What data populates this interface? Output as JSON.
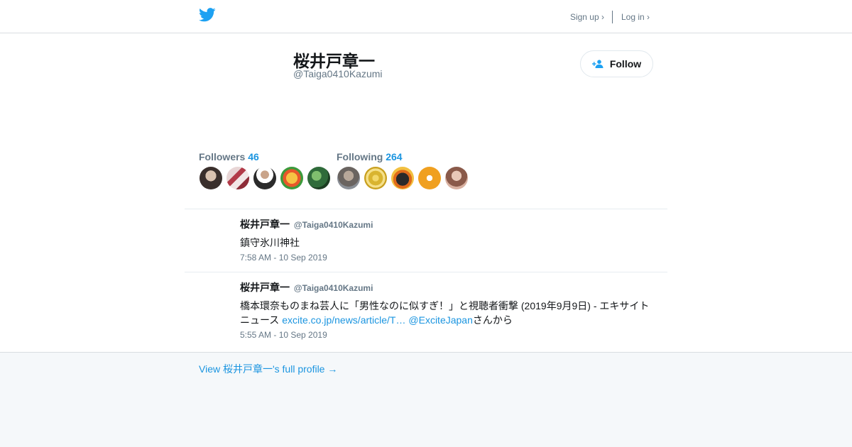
{
  "topbar": {
    "logo_icon": "twitter-bird-icon",
    "sign_up": "Sign up ›",
    "log_in": "Log in ›"
  },
  "profile": {
    "name": "桜井戸章一",
    "handle": "@Taiga0410Kazumi",
    "follow_label": "Follow"
  },
  "stats": {
    "followers_label": "Followers",
    "followers_count": "46",
    "following_label": "Following",
    "following_count": "264"
  },
  "tweets": [
    {
      "name": "桜井戸章一",
      "handle": "@Taiga0410Kazumi",
      "text": "鎮守氷川神社",
      "time": "7:58 AM - 10 Sep 2019"
    },
    {
      "name": "桜井戸章一",
      "handle": "@Taiga0410Kazumi",
      "text_part1": "橋本環奈ものまね芸人に「男性なのに似すぎ！」と視聴者衝撃 (2019年9月9日) - エキサイトニュース ",
      "link": "excite.co.jp/news/article/T…",
      "mention": "@ExciteJapan",
      "text_part2": "さんから",
      "time": "5:55 AM - 10 Sep 2019"
    }
  ],
  "footer": {
    "full_profile": "View 桜井戸章一's full profile →"
  },
  "colors": {
    "accent": "#1b95e0",
    "twitter_blue": "#1da1f2",
    "muted": "#657786",
    "footer_bg": "#f5f8fa"
  }
}
